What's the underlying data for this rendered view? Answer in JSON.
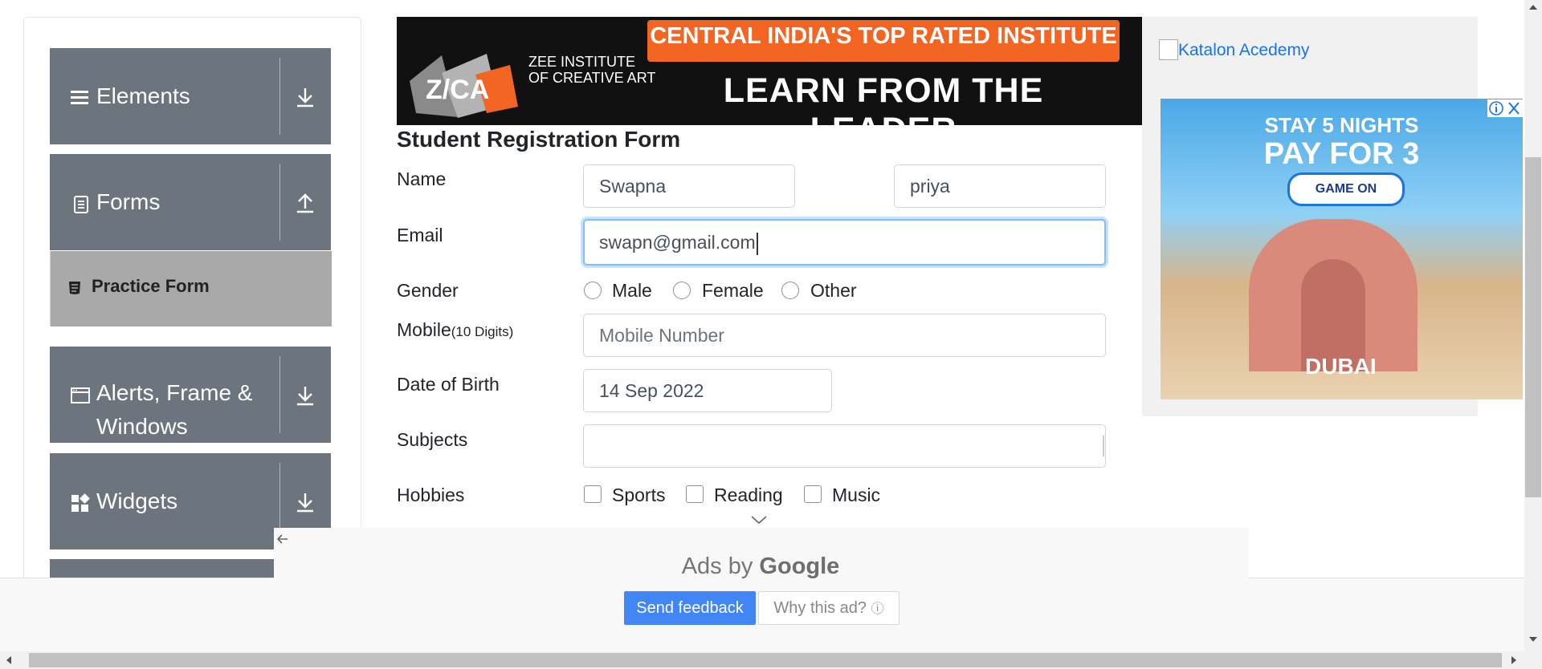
{
  "sidebar": {
    "items": [
      {
        "label": "Elements",
        "icon": "menu-icon",
        "arrow": "download-arrow-icon"
      },
      {
        "label": "Forms",
        "icon": "document-icon",
        "arrow": "upload-arrow-icon"
      },
      {
        "label": "Alerts, Frame &",
        "label2": "Windows",
        "icon": "window-icon",
        "arrow": "download-arrow-icon"
      },
      {
        "label": "Widgets",
        "icon": "widgets-icon",
        "arrow": "download-arrow-icon"
      }
    ],
    "active_sub_item": {
      "label": "Practice Form",
      "icon": "form-icon"
    }
  },
  "banner": {
    "logo_text": "Z/CA",
    "institute_line1": "ZEE INSTITUTE",
    "institute_line2": "OF CREATIVE ART",
    "headline": "CENTRAL INDIA'S TOP RATED INSTITUTE",
    "tagline": "LEARN FROM THE LEADER"
  },
  "form": {
    "title": "Student Registration Form",
    "name_label": "Name",
    "first_name_value": "Swapna",
    "last_name_value": "priya",
    "email_label": "Email",
    "email_value": "swapn@gmail.com",
    "gender_label": "Gender",
    "gender_options": [
      "Male",
      "Female",
      "Other"
    ],
    "mobile_label": "Mobile",
    "mobile_hint": "(10 Digits)",
    "mobile_placeholder": "Mobile Number",
    "dob_label": "Date of Birth",
    "dob_value": "14 Sep 2022",
    "subjects_label": "Subjects",
    "subjects_value": "",
    "hobbies_label": "Hobbies",
    "hobbies_options": [
      "Sports",
      "Reading",
      "Music"
    ]
  },
  "right_ad": {
    "link_text": "Katalon Acedemy",
    "line1": "STAY 5 NIGHTS",
    "line2": "PAY FOR 3",
    "button": "GAME ON",
    "brand": "DUBAI"
  },
  "bottom_ad": {
    "ads_by": "Ads by",
    "google": "Google",
    "send_feedback": "Send feedback",
    "why_this_ad": "Why this ad?"
  },
  "colors": {
    "sidebar_bg": "#6c757d",
    "active_sub_bg": "#a9a9a9",
    "focus_border": "#80bdff",
    "feedback_blue": "#4285f4",
    "link_blue": "#1a73e8"
  }
}
